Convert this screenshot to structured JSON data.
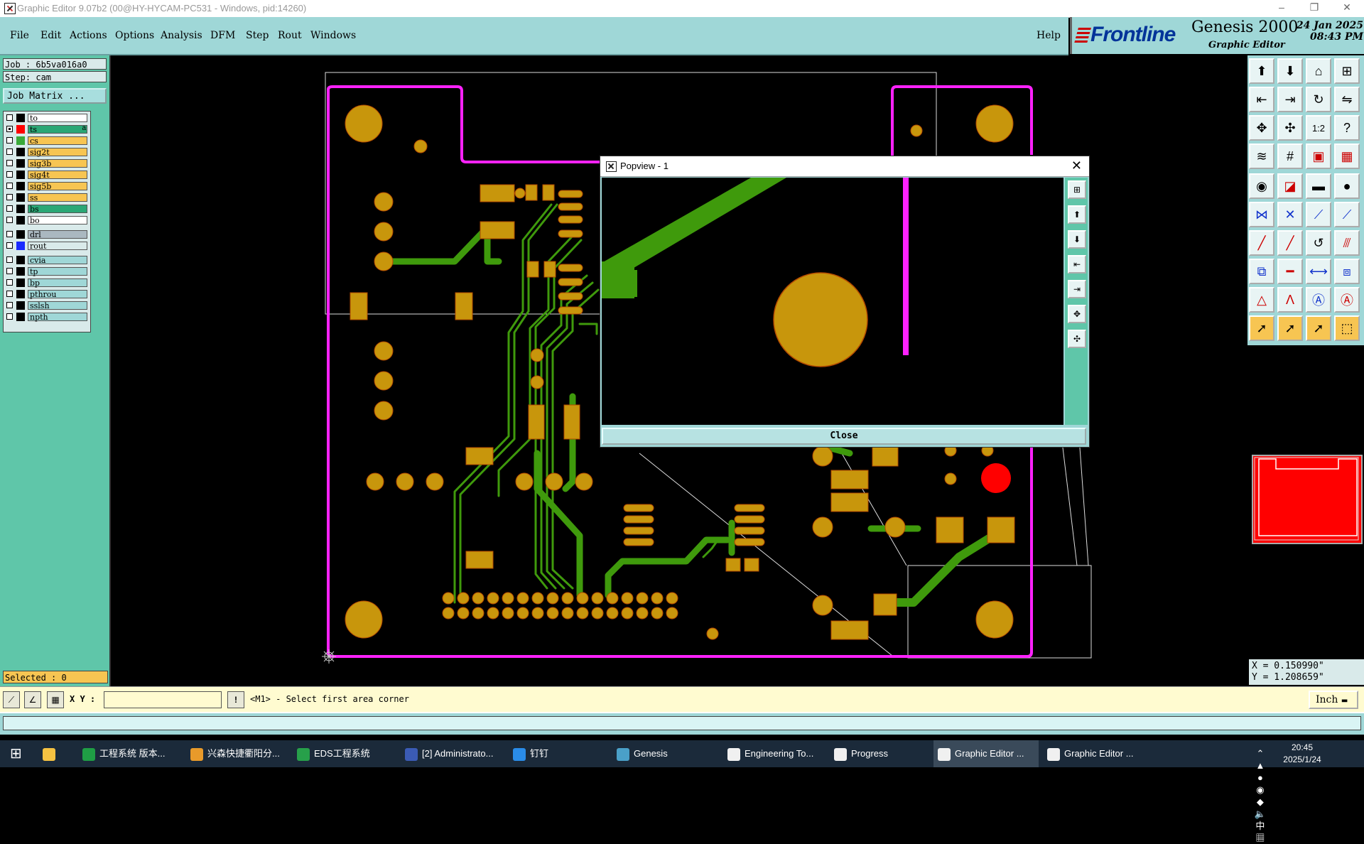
{
  "window": {
    "title": "Graphic Editor 9.07b2 (00@HY-HYCAM-PC531 - Windows, pid:14260)"
  },
  "menu": {
    "items": [
      {
        "label": "File"
      },
      {
        "label": "Edit"
      },
      {
        "label": "Actions"
      },
      {
        "label": "Options"
      },
      {
        "label": "Analysis"
      },
      {
        "label": "DFM"
      },
      {
        "label": "Step"
      },
      {
        "label": "Rout"
      },
      {
        "label": "Windows"
      }
    ],
    "help": "Help"
  },
  "brand": {
    "logo": "Frontline",
    "product": "Genesis 2000",
    "subtitle": "Graphic Editor",
    "date": "24 Jan 2025",
    "time": "08:43 PM"
  },
  "job": {
    "job_line": "Job  :  6b5va016a0",
    "step_line": "Step:  cam",
    "matrix_button": "Job Matrix ..."
  },
  "layers": [
    {
      "name": "to",
      "color": "#ffffff",
      "swatch": "#000000",
      "checked": false
    },
    {
      "name": "ts",
      "color": "#2aa775",
      "swatch": "#ff0000",
      "checked": true,
      "flag": "a"
    },
    {
      "name": "cs",
      "color": "#f7c552",
      "swatch": "#3aaa3a",
      "checked": false
    },
    {
      "name": "sig2t",
      "color": "#f7c552",
      "swatch": "#000000",
      "checked": false
    },
    {
      "name": "sig3b",
      "color": "#f7c552",
      "swatch": "#000000",
      "checked": false
    },
    {
      "name": "sig4t",
      "color": "#f7c552",
      "swatch": "#000000",
      "checked": false
    },
    {
      "name": "sig5b",
      "color": "#f7c552",
      "swatch": "#000000",
      "checked": false
    },
    {
      "name": "ss",
      "color": "#f7c552",
      "swatch": "#000000",
      "checked": false
    },
    {
      "name": "bs",
      "color": "#2aa775",
      "swatch": "#000000",
      "checked": false
    },
    {
      "name": "bo",
      "color": "#ffffff",
      "swatch": "#000000",
      "checked": false
    },
    {
      "name": "drl",
      "color": "#aab8c0",
      "swatch": "#000000",
      "checked": false
    },
    {
      "name": "rout",
      "color": "#d9eaea",
      "swatch": "#1a2aff",
      "checked": false
    },
    {
      "name": "cvia",
      "color": "#9fd7d7",
      "swatch": "#000000",
      "checked": false
    },
    {
      "name": "tp",
      "color": "#9fd7d7",
      "swatch": "#000000",
      "checked": false
    },
    {
      "name": "bp",
      "color": "#9fd7d7",
      "swatch": "#000000",
      "checked": false
    },
    {
      "name": "pthrou",
      "color": "#9fd7d7",
      "swatch": "#000000",
      "checked": false
    },
    {
      "name": "sslsh",
      "color": "#9fd7d7",
      "swatch": "#000000",
      "checked": false
    },
    {
      "name": "npth",
      "color": "#9fd7d7",
      "swatch": "#000000",
      "checked": false
    }
  ],
  "selected": "Selected : 0",
  "popview": {
    "title": "Popview - 1",
    "close_label": "Close"
  },
  "coords": {
    "x": "X = 0.150990\"",
    "y": "Y = 1.208659\""
  },
  "command": {
    "xy_label": "X Y :",
    "xy_value": "",
    "message": "<M1> - Select first area corner",
    "unit": "Inch"
  },
  "colors": {
    "board_outline": "#ff22ff",
    "pad": "#c8960c",
    "trace": "#3f9a0c",
    "selected_pad": "#ff0000"
  },
  "taskbar": {
    "items": [
      {
        "label": "工程系统  版本...",
        "icon": "green-p-icon"
      },
      {
        "label": "兴森快捷衢阳分...",
        "icon": "orange-app-icon"
      },
      {
        "label": "EDS工程系统",
        "icon": "green-eds-icon"
      },
      {
        "label": "[2] Administrato...",
        "icon": "floppy-icon"
      },
      {
        "label": "钉钉",
        "icon": "dingtalk-icon"
      },
      {
        "label": "Genesis",
        "icon": "genesis-icon"
      },
      {
        "label": "Engineering To...",
        "icon": "graphic-editor-icon"
      },
      {
        "label": "Progress",
        "icon": "graphic-editor-icon"
      },
      {
        "label": "Graphic Editor ...",
        "icon": "graphic-editor-icon",
        "active": true
      },
      {
        "label": "Graphic Editor ...",
        "icon": "graphic-editor-icon"
      }
    ],
    "tray": {
      "ime": "中",
      "time": "20:45",
      "date": "2025/1/24"
    }
  }
}
